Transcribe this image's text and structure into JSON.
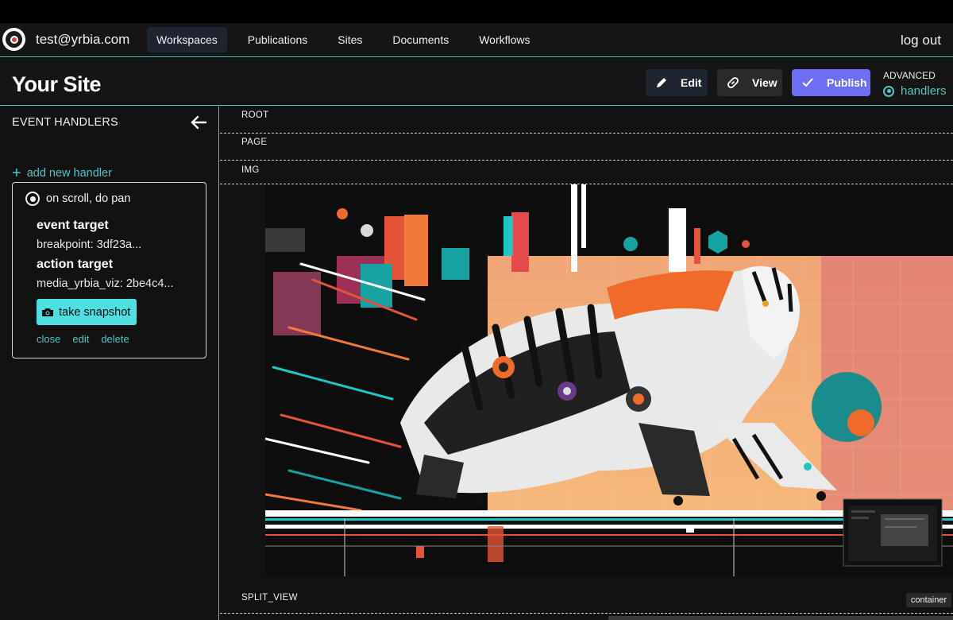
{
  "user": {
    "email": "test@yrbia.com"
  },
  "nav": {
    "items": [
      {
        "label": "Workspaces",
        "active": true
      },
      {
        "label": "Publications",
        "active": false
      },
      {
        "label": "Sites",
        "active": false
      },
      {
        "label": "Documents",
        "active": false
      },
      {
        "label": "Workflows",
        "active": false
      }
    ],
    "logout": "log out"
  },
  "header": {
    "title": "Your Site",
    "edit_label": "Edit",
    "view_label": "View",
    "publish_label": "Publish",
    "advanced_label": "ADVANCED",
    "handlers_label": "handlers"
  },
  "sidebar": {
    "title": "EVENT HANDLERS",
    "add_label": "add new handler",
    "handler": {
      "name": "on scroll, do pan",
      "event_target_label": "event target",
      "event_target_value": "breakpoint: 3df23a...",
      "action_target_label": "action target",
      "action_target_value": "media_yrbia_viz: 2be4c4...",
      "snapshot_label": "take snapshot",
      "close_label": "close",
      "edit_label": "edit",
      "delete_label": "delete"
    }
  },
  "canvas": {
    "crumbs": [
      "ROOT",
      "PAGE",
      "IMG"
    ],
    "split_label": "SPLIT_VIEW",
    "container_badge": "container"
  },
  "colors": {
    "accent": "#4ec6c6",
    "publish": "#6f6df5",
    "snapshot": "#4ee0e0",
    "background": "#121212"
  }
}
